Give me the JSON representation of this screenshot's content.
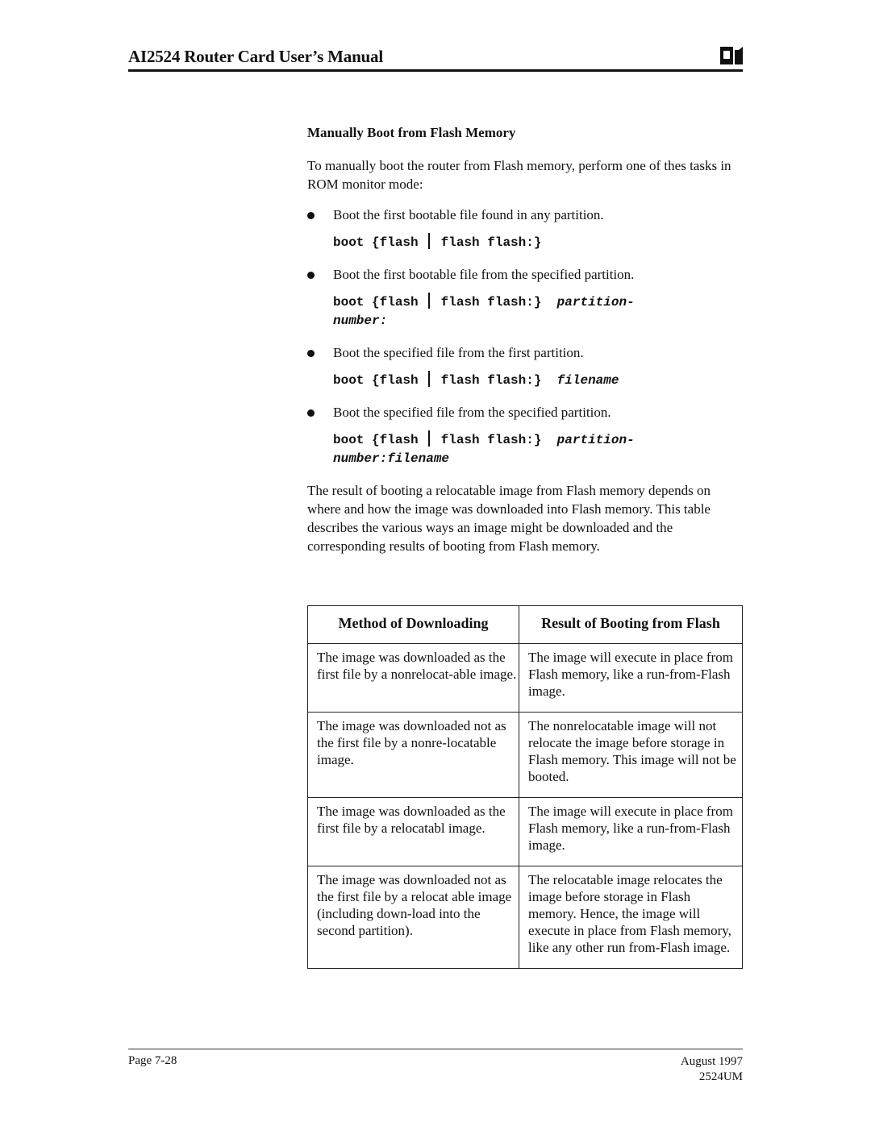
{
  "header": {
    "title": "AI2524 Router Card User’s Manual",
    "logo": "company-logo"
  },
  "section": {
    "title": "Manually Boot from Flash Memory",
    "intro": "To manually boot the router from Flash memory, perform one of thes tasks in ROM monitor mode:"
  },
  "tasks": [
    {
      "bullet": "Boot the first bootable file found in any partition.",
      "cmd_prefix": "boot {flash",
      "cmd_mid": "flash flash:}",
      "cmd_arg_line1": "",
      "cmd_arg_line2": ""
    },
    {
      "bullet": "Boot the first bootable file from the specified partition.",
      "cmd_prefix": "boot {flash",
      "cmd_mid": "flash flash:}",
      "cmd_arg_line1": "partition-",
      "cmd_arg_line2": "number:"
    },
    {
      "bullet": "Boot the specified file from the first partition.",
      "cmd_prefix": "boot {flash",
      "cmd_mid": "flash flash:}",
      "cmd_arg_line1": "filename",
      "cmd_arg_line2": ""
    },
    {
      "bullet": "Boot the specified file from the specified partition.",
      "cmd_prefix": "boot {flash",
      "cmd_mid": "flash flash:}",
      "cmd_arg_line1": "partition-",
      "cmd_arg_line2": "number:filename"
    }
  ],
  "paragraph": "The result of booting a relocatable image from Flash memory depends on where and how the image was downloaded into Flash memory. This table describes the various ways an image might be downloaded and the corresponding results of booting from Flash memory.",
  "table": {
    "headers": [
      "Method of Downloading",
      "Result of Booting from Flash"
    ],
    "rows": [
      [
        "The image was downloaded as the first file by a nonrelocat-able image.",
        "The image will execute in place from Flash memory, like a run-from-Flash image."
      ],
      [
        "The image was downloaded not as the first file by a nonre-locatable image.",
        "The nonrelocatable image will not relocate the image before storage in Flash memory. This image will not be booted."
      ],
      [
        "The image was downloaded as the first file by a relocatabl image.",
        "The image will execute in place from Flash memory, like a run-from-Flash image."
      ],
      [
        "The image was downloaded not as the first file by a relocat able image (including down-load into the second partition).",
        "The relocatable image relocates the image before storage in Flash memory. Hence, the image will execute in place from Flash memory, like any other run from-Flash image."
      ]
    ]
  },
  "footer": {
    "page": "Page 7-28",
    "date": "August 1997",
    "doc_id": "2524UM"
  }
}
